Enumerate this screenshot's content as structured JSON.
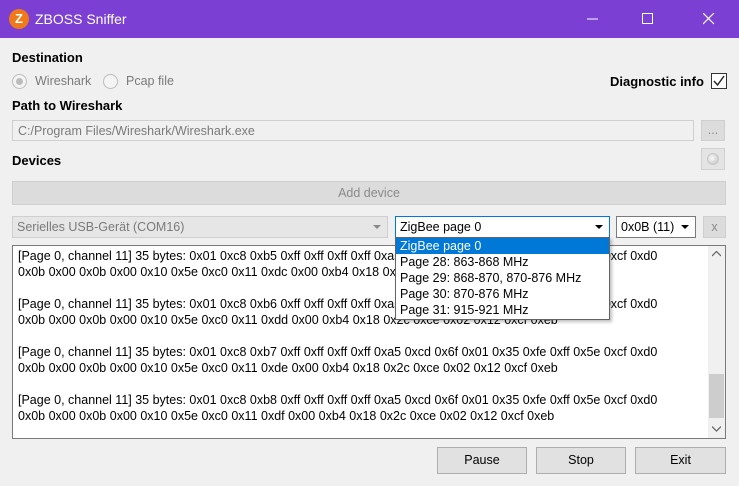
{
  "window": {
    "title": "ZBOSS Sniffer",
    "logo_letter": "Z",
    "accent": "#7b3fd3"
  },
  "destination": {
    "label": "Destination",
    "options": [
      {
        "label": "Wireshark",
        "checked": true
      },
      {
        "label": "Pcap file",
        "checked": false
      }
    ],
    "diagnostic_label": "Diagnostic info",
    "diagnostic_checked": true
  },
  "path": {
    "label": "Path to Wireshark",
    "value": "C:/Program Files/Wireshark/Wireshark.exe",
    "browse_label": "..."
  },
  "devices": {
    "label": "Devices",
    "add_label": "Add device",
    "port_value": "Serielles USB-Gerät (COM16)",
    "page_value": "ZigBee page 0",
    "channel_value": "0x0B (11)",
    "remove_label": "x",
    "page_options": [
      "ZigBee page 0",
      "Page 28: 863-868 MHz",
      "Page 29: 868-870, 870-876 MHz",
      "Page 30: 870-876 MHz",
      "Page 31: 915-921 MHz"
    ]
  },
  "log": {
    "entries": [
      {
        "line1": "[Page 0, channel 11] 35 bytes: 0x01 0xc8 0xb5 0xff 0xff 0xff 0xff 0xa5 0xcd 0x6f 0x01 0x35 0xfe 0xff 0x5e 0xcf 0xd0",
        "line2": "0x0b 0x00 0x0b 0x00 0x10 0x5e 0xc0 0x11 0xdc 0x00 0xb4 0x18 0x2c 0xce 0x02 0x12 0xcf 0xeb"
      },
      {
        "line1": "[Page 0, channel 11] 35 bytes: 0x01 0xc8 0xb6 0xff 0xff 0xff 0xff 0xa5 0xcd 0x6f 0x01 0x35 0xfe 0xff 0x5e 0xcf 0xd0",
        "line2": "0x0b 0x00 0x0b 0x00 0x10 0x5e 0xc0 0x11 0xdd 0x00 0xb4 0x18 0x2c 0xce 0x02 0x12 0xcf 0xeb"
      },
      {
        "line1": "[Page 0, channel 11] 35 bytes: 0x01 0xc8 0xb7 0xff 0xff 0xff 0xff 0xa5 0xcd 0x6f 0x01 0x35 0xfe 0xff 0x5e 0xcf 0xd0",
        "line2": "0x0b 0x00 0x0b 0x00 0x10 0x5e 0xc0 0x11 0xde 0x00 0xb4 0x18 0x2c 0xce 0x02 0x12 0xcf 0xeb"
      },
      {
        "line1": "[Page 0, channel 11] 35 bytes: 0x01 0xc8 0xb8 0xff 0xff 0xff 0xff 0xa5 0xcd 0x6f 0x01 0x35 0xfe 0xff 0x5e 0xcf 0xd0",
        "line2": "0x0b 0x00 0x0b 0x00 0x10 0x5e 0xc0 0x11 0xdf 0x00 0xb4 0x18 0x2c 0xce 0x02 0x12 0xcf 0xeb"
      }
    ]
  },
  "actions": {
    "pause": "Pause",
    "stop": "Stop",
    "exit": "Exit"
  }
}
